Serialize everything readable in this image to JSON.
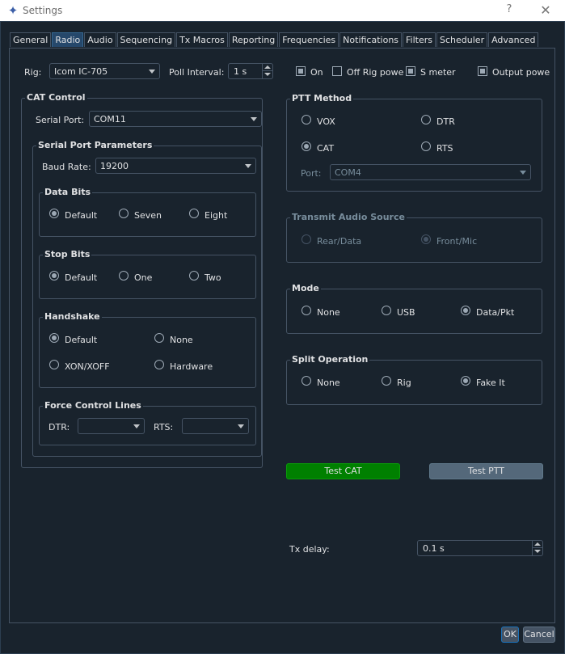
{
  "window": {
    "title": "Settings",
    "help_glyph": "?",
    "close_glyph": "✕",
    "app_icon": "✦"
  },
  "colors": {
    "background": "#19232d",
    "border": "#455364",
    "active_tab": "#26486b",
    "test_cat_button": "#008000",
    "accent": "#346792"
  },
  "tabs": [
    "General",
    "Radio",
    "Audio",
    "Sequencing",
    "Tx Macros",
    "Reporting",
    "Frequencies",
    "Notifications",
    "Filters",
    "Scheduler",
    "Advanced"
  ],
  "active_tab": "Radio",
  "rig": {
    "label": "Rig:",
    "value": "Icom IC-705"
  },
  "poll": {
    "label": "Poll Interval:",
    "value": "1 s"
  },
  "options": {
    "on": "On",
    "off_rig_power": "Off Rig powe",
    "s_meter": "S meter",
    "output_power": "Output powe"
  },
  "cat": {
    "title": "CAT Control",
    "serial_port_label": "Serial Port:",
    "serial_port_value": "COM11",
    "params_title": "Serial Port Parameters",
    "baud_label": "Baud Rate:",
    "baud_value": "19200",
    "data_bits": {
      "title": "Data Bits",
      "opts": [
        "Default",
        "Seven",
        "Eight"
      ]
    },
    "stop_bits": {
      "title": "Stop Bits",
      "opts": [
        "Default",
        "One",
        "Two"
      ]
    },
    "handshake": {
      "title": "Handshake",
      "opts": [
        "Default",
        "None",
        "XON/XOFF",
        "Hardware"
      ]
    },
    "force": {
      "title": "Force Control Lines",
      "dtr": "DTR:",
      "rts": "RTS:"
    }
  },
  "ptt": {
    "title": "PTT Method",
    "opts": [
      "VOX",
      "DTR",
      "CAT",
      "RTS"
    ],
    "port_label": "Port:",
    "port_value": "COM4"
  },
  "audio_source": {
    "title": "Transmit Audio Source",
    "opts": [
      "Rear/Data",
      "Front/Mic"
    ]
  },
  "mode": {
    "title": "Mode",
    "opts": [
      "None",
      "USB",
      "Data/Pkt"
    ]
  },
  "split": {
    "title": "Split Operation",
    "opts": [
      "None",
      "Rig",
      "Fake It"
    ]
  },
  "buttons": {
    "test_cat": "Test CAT",
    "test_ptt": "Test PTT",
    "ok": "OK",
    "cancel": "Cancel"
  },
  "tx_delay": {
    "label": "Tx delay:",
    "value": "0.1 s"
  }
}
